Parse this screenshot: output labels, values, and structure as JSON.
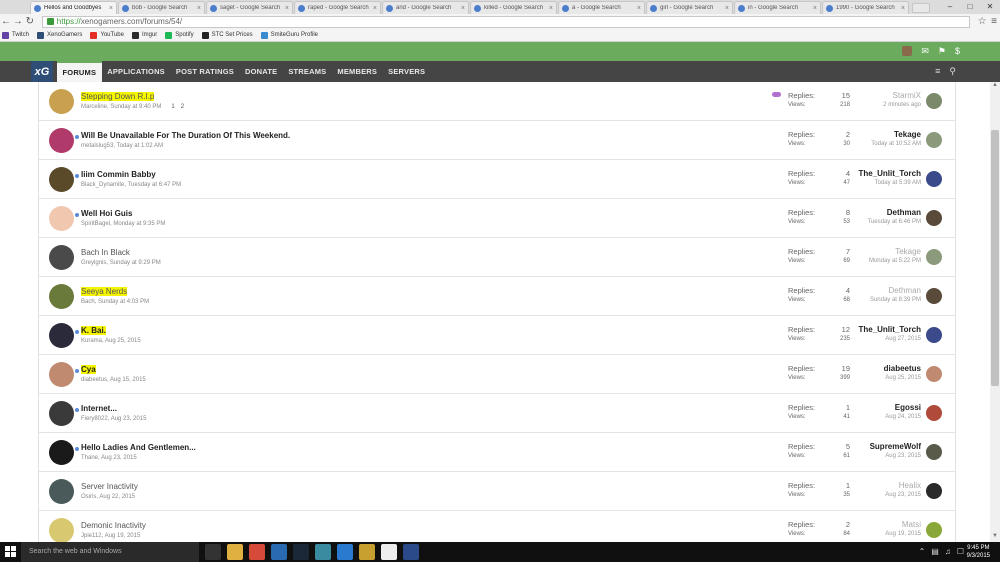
{
  "tabs": [
    {
      "label": "Hellos and Goodbyes",
      "active": true
    },
    {
      "label": "bob - Google Search",
      "active": false
    },
    {
      "label": "saget - Google Search",
      "active": false
    },
    {
      "label": "raped - Google Search",
      "active": false
    },
    {
      "label": "and - Google Search",
      "active": false
    },
    {
      "label": "killed - Google Search",
      "active": false
    },
    {
      "label": "a - Google Search",
      "active": false
    },
    {
      "label": "girl - Google Search",
      "active": false
    },
    {
      "label": "in - Google Search",
      "active": false
    },
    {
      "label": "1990 - Google Search",
      "active": false
    }
  ],
  "url": {
    "scheme": "https://",
    "rest": "xenogamers.com/forums/54/"
  },
  "bookmarks": [
    {
      "label": "Twitch",
      "color": "#6441a5"
    },
    {
      "label": "XenoGamers",
      "color": "#2e4e78"
    },
    {
      "label": "YouTube",
      "color": "#e52d27"
    },
    {
      "label": "Imgur",
      "color": "#2b2b2b"
    },
    {
      "label": "Spotify",
      "color": "#1db954"
    },
    {
      "label": "STC Set Prices",
      "color": "#222222"
    },
    {
      "label": "SmiteGuru Profile",
      "color": "#3a8ad0"
    }
  ],
  "logo": "xG",
  "nav": {
    "items": [
      "FORUMS",
      "APPLICATIONS",
      "POST RATINGS",
      "DONATE",
      "STREAMS",
      "MEMBERS",
      "SERVERS"
    ],
    "active": "FORUMS"
  },
  "labels": {
    "replies": "Replies:",
    "views": "Views:",
    "search_placeholder": "Search the web and Windows"
  },
  "threads": [
    {
      "title": "Stepping Down R.I.p",
      "style": "normal",
      "highlight": true,
      "unread": false,
      "author": "Marceline",
      "date": "Sunday at 9:40 PM",
      "pages": "1  2",
      "replies": "15",
      "views": "218",
      "last_user": "StarmiX",
      "last_date": "2 minutes ago",
      "last_faded": true,
      "avatar": "#c8a050",
      "last_avatar": "#7a8a6a",
      "mood": true
    },
    {
      "title": "Will Be Unavailable For The Duration Of This Weekend.",
      "style": "bold",
      "highlight": false,
      "unread": true,
      "author": "metalslug53",
      "date": "Today at 1:02 AM",
      "replies": "2",
      "views": "30",
      "last_user": "Tekage",
      "last_date": "Today at 10:52 AM",
      "last_faded": false,
      "avatar": "#b03a6a",
      "last_avatar": "#8a9a7a"
    },
    {
      "title": "Iiim Commin Babby",
      "style": "bold",
      "highlight": false,
      "unread": true,
      "author": "Black_Dynamite",
      "date": "Tuesday at 6:47 PM",
      "replies": "4",
      "views": "47",
      "last_user": "The_Unlit_Torch",
      "last_date": "Today at 5:39 AM",
      "last_faded": false,
      "avatar": "#5a4a2a",
      "last_avatar": "#3a4a8a"
    },
    {
      "title": "Well Hoi Guis",
      "style": "bold",
      "highlight": false,
      "unread": true,
      "author": "SpiritBagel",
      "date": "Monday at 9:35 PM",
      "replies": "8",
      "views": "53",
      "last_user": "Dethman",
      "last_date": "Tuesday at 6:46 PM",
      "last_faded": false,
      "avatar": "#f0c8b0",
      "last_avatar": "#5a4a3a"
    },
    {
      "title": "Bach In Black",
      "style": "normal",
      "highlight": false,
      "unread": false,
      "author": "Greylgnis",
      "date": "Sunday at 9:29 PM",
      "replies": "7",
      "views": "69",
      "last_user": "Tekage",
      "last_date": "Monday at 5:22 PM",
      "last_faded": true,
      "avatar": "#4a4a4a",
      "last_avatar": "#8a9a7a"
    },
    {
      "title": "Seeya Nerds",
      "style": "normal",
      "highlight": true,
      "unread": false,
      "author": "Bach",
      "date": "Sunday at 4:03 PM",
      "replies": "4",
      "views": "68",
      "last_user": "Dethman",
      "last_date": "Sunday at 8:39 PM",
      "last_faded": true,
      "avatar": "#6a7a3a",
      "last_avatar": "#5a4a3a"
    },
    {
      "title": "K. Bai.",
      "style": "bold",
      "highlight": true,
      "unread": true,
      "author": "Kurama",
      "date": "Aug 25, 2015",
      "replies": "12",
      "views": "235",
      "last_user": "The_Unlit_Torch",
      "last_date": "Aug 27, 2015",
      "last_faded": false,
      "avatar": "#2a2a3a",
      "last_avatar": "#3a4a8a"
    },
    {
      "title": "Cya",
      "style": "bold",
      "highlight": true,
      "unread": true,
      "author": "diabeetus",
      "date": "Aug 15, 2015",
      "replies": "19",
      "views": "399",
      "last_user": "diabeetus",
      "last_date": "Aug 25, 2015",
      "last_faded": false,
      "avatar": "#c08a70",
      "last_avatar": "#c08a70"
    },
    {
      "title": "Internet...",
      "style": "bold",
      "highlight": false,
      "unread": true,
      "author": "Fiery8022",
      "date": "Aug 23, 2015",
      "replies": "1",
      "views": "41",
      "last_user": "Egossi",
      "last_date": "Aug 24, 2015",
      "last_faded": false,
      "avatar": "#3a3a3a",
      "last_avatar": "#b04a3a"
    },
    {
      "title": "Hello Ladies And Gentlemen...",
      "style": "bold",
      "highlight": false,
      "unread": true,
      "author": "Thane",
      "date": "Aug 23, 2015",
      "replies": "5",
      "views": "61",
      "last_user": "SupremeWolf",
      "last_date": "Aug 23, 2015",
      "last_faded": false,
      "avatar": "#1a1a1a",
      "last_avatar": "#5a5a4a"
    },
    {
      "title": "Server Inactivity",
      "style": "normal",
      "highlight": false,
      "unread": false,
      "author": "Osiris",
      "date": "Aug 22, 2015",
      "replies": "1",
      "views": "35",
      "last_user": "Healix",
      "last_date": "Aug 23, 2015",
      "last_faded": true,
      "avatar": "#4a5a5a",
      "last_avatar": "#2a2a2a"
    },
    {
      "title": "Demonic Inactivity",
      "style": "normal",
      "highlight": false,
      "unread": false,
      "author": "Jpie112",
      "date": "Aug 19, 2015",
      "replies": "2",
      "views": "84",
      "last_user": "Matsi",
      "last_date": "Aug 19, 2015",
      "last_faded": true,
      "avatar": "#d8c870",
      "last_avatar": "#8aa83a"
    }
  ],
  "clock": {
    "time": "9:45 PM",
    "date": "9/3/2015"
  },
  "taskbar_icons": [
    {
      "name": "task-view",
      "color": "#333333"
    },
    {
      "name": "file-explorer",
      "color": "#e0b040"
    },
    {
      "name": "chrome",
      "color": "#d64a3a"
    },
    {
      "name": "app-blue",
      "color": "#2a6ab0"
    },
    {
      "name": "steam",
      "color": "#1b2838"
    },
    {
      "name": "app-teal",
      "color": "#3a8aa0"
    },
    {
      "name": "app-arrow",
      "color": "#2a7ad0"
    },
    {
      "name": "app-gold",
      "color": "#c8a030"
    },
    {
      "name": "app-white",
      "color": "#eeeeee"
    },
    {
      "name": "league",
      "color": "#2a4a8a"
    }
  ]
}
